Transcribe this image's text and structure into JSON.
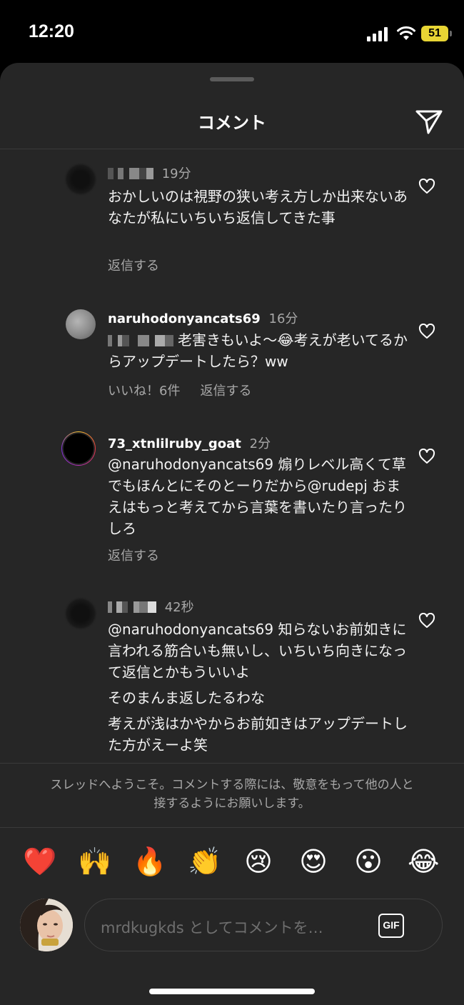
{
  "status_bar": {
    "time": "12:20",
    "battery": "51"
  },
  "header": {
    "title": "コメント",
    "send_icon": "paper-plane-icon"
  },
  "comments": [
    {
      "username": "",
      "time_ago": "19分",
      "lines": [
        "おかしいのは視野の狭い考え方しか出来ないあなたが私にいちいち返信してきた事"
      ],
      "likes": "",
      "reply": "返信する"
    },
    {
      "username": "naruhodonyancats69",
      "time_ago": "16分",
      "lines": [
        "老害きもいよ〜😂考えが老いてるからアップデートしたら？ww"
      ],
      "likes": "いいね！6件",
      "reply": "返信する"
    },
    {
      "username": "73_xtnlilruby_goat",
      "time_ago": "2分",
      "lines": [
        "@naruhodonyancats69 煽りレベル高くて草でもほんとにそのとーりだから@rudepj おまえはもっと考えてから言葉を書いたり言ったりしろ"
      ],
      "likes": "",
      "reply": "返信する"
    },
    {
      "username": "",
      "time_ago": "42秒",
      "lines": [
        "@naruhodonyancats69 知らないお前如きに言われる筋合いも無いし、いちいち向きになって返信とかもういいよ",
        "そのまんま返したるわな",
        "考えが浅はかやからお前如きはアップデートした方がえーよ笑"
      ],
      "likes": "",
      "reply": ""
    }
  ],
  "footer": {
    "welcome": "スレッドへようこそ。コメントする際には、敬意をもって他の人と接するようにお願いします。",
    "emojis": [
      "❤️",
      "🙌",
      "🔥",
      "👏",
      "😢",
      "😍",
      "😮",
      "😂"
    ],
    "input_placeholder": "mrdkugkds としてコメントを…",
    "gif_label": "GIF"
  },
  "colors": {
    "sheet_bg": "#262626",
    "text_secondary": "#a8a8a8",
    "accent_battery": "#e8d534"
  }
}
